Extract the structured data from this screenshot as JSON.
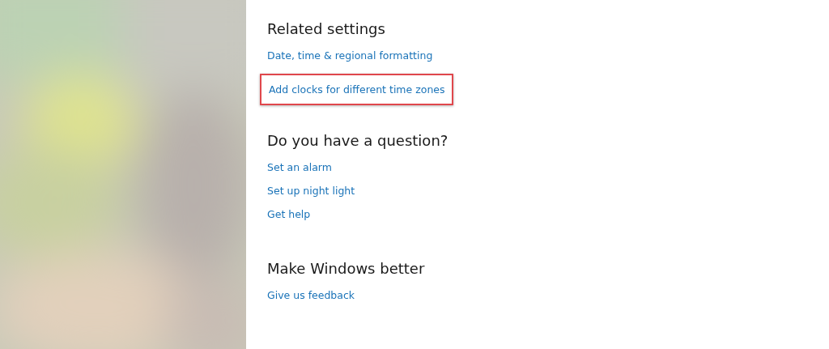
{
  "sections": [
    {
      "heading": "Related settings",
      "links": [
        {
          "label": "Date, time & regional formatting",
          "highlighted": false
        },
        {
          "label": "Add clocks for different time zones",
          "highlighted": true
        }
      ]
    },
    {
      "heading": "Do you have a question?",
      "links": [
        {
          "label": "Set an alarm",
          "highlighted": false
        },
        {
          "label": "Set up night light",
          "highlighted": false
        },
        {
          "label": "Get help",
          "highlighted": false
        }
      ]
    },
    {
      "heading": "Make Windows better",
      "links": [
        {
          "label": "Give us feedback",
          "highlighted": false
        }
      ]
    }
  ]
}
